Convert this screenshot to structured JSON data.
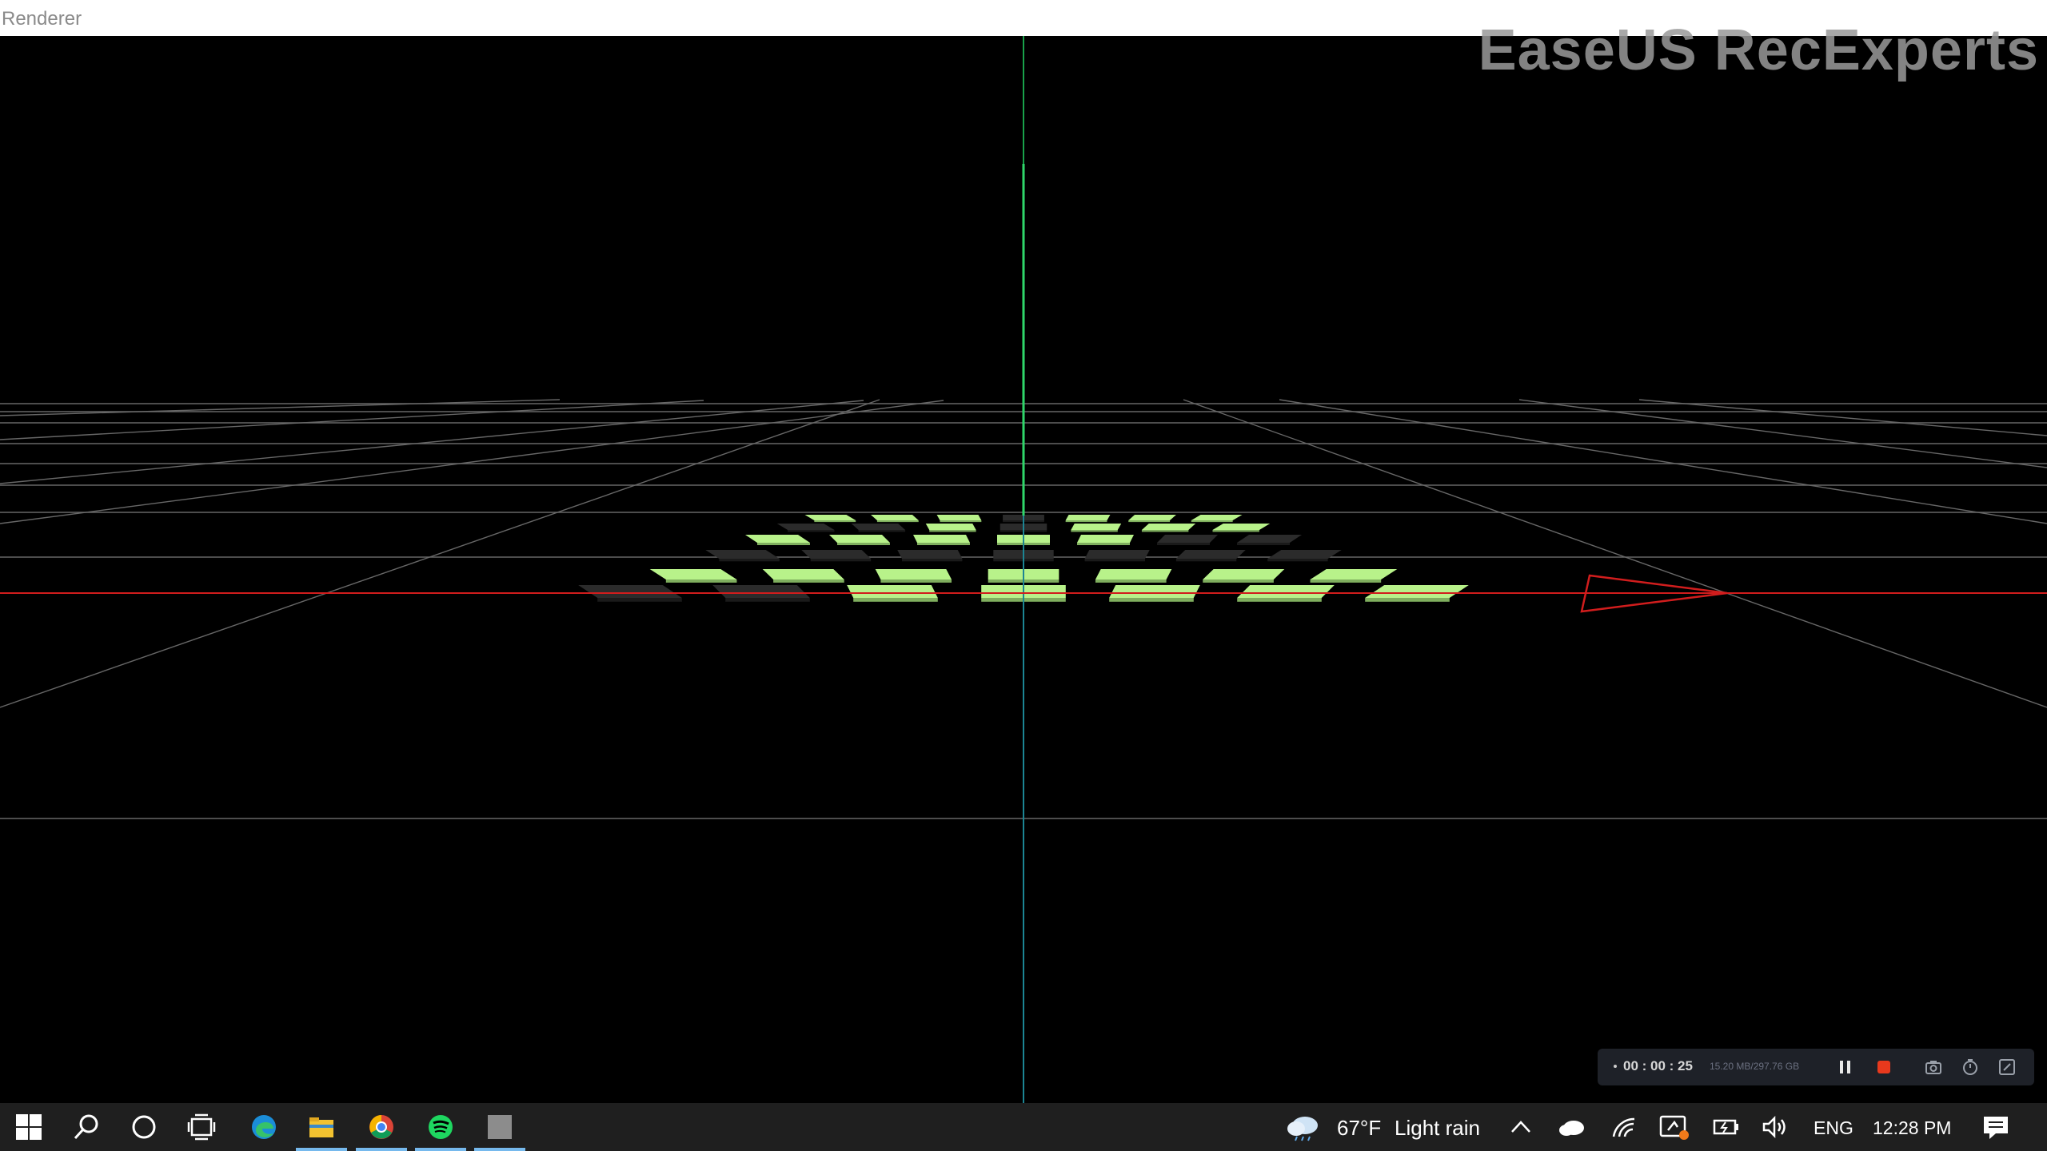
{
  "window": {
    "title": "Renderer"
  },
  "watermark": {
    "text": "EaseUS RecExperts"
  },
  "recorder": {
    "time": "00 : 00 : 25",
    "storage": "15.20 MB/297.76 GB",
    "record_color": "#e8391d"
  },
  "scene": {
    "x_axis_color": "#d11d1d",
    "y_axis_color": "#19a24a",
    "z_axis_color": "#1f6fd0",
    "tile_lit_color": "#b8f28a",
    "tile_dark_color": "#2b2b2b"
  },
  "taskbar": {
    "apps": [
      "start-button",
      "search",
      "cortana",
      "task-view",
      "edge",
      "file-explorer",
      "chrome",
      "spotify",
      "renderer-app"
    ],
    "weather_temp": "67°F",
    "weather_text": "Light rain",
    "language": "ENG",
    "clock": "12:28 PM"
  }
}
